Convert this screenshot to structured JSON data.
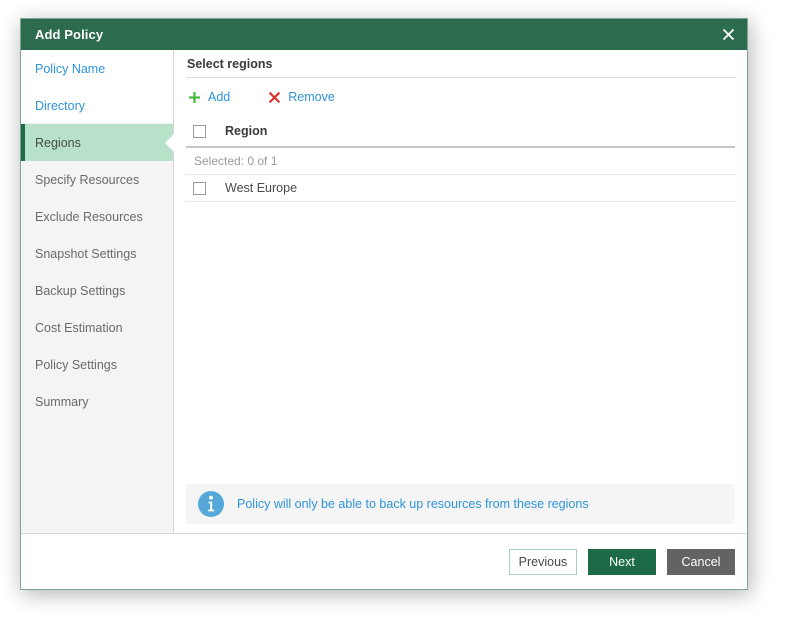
{
  "window": {
    "title": "Add Policy",
    "close_icon": "close-icon"
  },
  "sidebar": {
    "items": [
      {
        "label": "Policy Name",
        "state": "done"
      },
      {
        "label": "Directory",
        "state": "done"
      },
      {
        "label": "Regions",
        "state": "active"
      },
      {
        "label": "Specify Resources",
        "state": "pending"
      },
      {
        "label": "Exclude Resources",
        "state": "pending"
      },
      {
        "label": "Snapshot Settings",
        "state": "pending"
      },
      {
        "label": "Backup Settings",
        "state": "pending"
      },
      {
        "label": "Cost Estimation",
        "state": "pending"
      },
      {
        "label": "Policy Settings",
        "state": "pending"
      },
      {
        "label": "Summary",
        "state": "pending"
      }
    ]
  },
  "main": {
    "title": "Select regions",
    "toolbar": {
      "add_label": "Add",
      "add_icon": "plus-icon",
      "remove_label": "Remove",
      "remove_icon": "x-icon"
    },
    "table": {
      "columns": [
        "Region"
      ],
      "selected_text": "Selected:  0 of 1",
      "rows": [
        {
          "name": "West Europe",
          "checked": false
        }
      ],
      "header_checked": false
    },
    "info": {
      "icon": "info-icon",
      "text": "Policy will only be able to back up resources from these regions"
    }
  },
  "footer": {
    "previous_label": "Previous",
    "next_label": "Next",
    "cancel_label": "Cancel"
  },
  "colors": {
    "title_bar_green": "#2d6b4e",
    "active_step_green": "#b7e1c9",
    "accent_bar_green": "#1e6b45",
    "link_blue": "#2f93d8",
    "add_icon_green": "#49b949",
    "remove_icon_red": "#d9342b",
    "next_button_green": "#1d6b46",
    "cancel_button_gray": "#636363",
    "sidebar_gray": "#f4f4f4",
    "info_bar_gray": "#f5f5f5"
  }
}
